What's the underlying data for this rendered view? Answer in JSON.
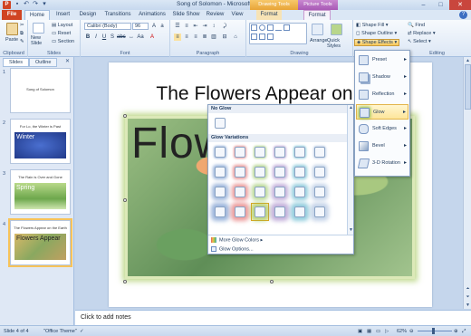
{
  "window": {
    "title": "Song of Solomon - Microsoft PowerPoint",
    "context_drawing": "Drawing Tools",
    "context_picture": "Picture Tools"
  },
  "tabs": [
    "File",
    "Home",
    "Insert",
    "Design",
    "Transitions",
    "Animations",
    "Slide Show",
    "Review",
    "View",
    "Format",
    "Format"
  ],
  "ribbon": {
    "clipboard": {
      "paste": "Paste",
      "label": "Clipboard"
    },
    "slides": {
      "new_slide": "New Slide",
      "layout": "Layout",
      "reset": "Reset",
      "section": "Section",
      "label": "Slides"
    },
    "font": {
      "name": "Calibri (Body)",
      "size": "96",
      "label": "Font"
    },
    "paragraph": {
      "label": "Paragraph"
    },
    "drawing": {
      "arrange": "Arrange",
      "quick_styles": "Quick Styles",
      "label": "Drawing"
    },
    "shape_fill": "Shape Fill",
    "shape_outline": "Shape Outline",
    "shape_effects": "Shape Effects",
    "editing": {
      "find": "Find",
      "replace": "Replace",
      "select": "Select",
      "label": "Editing"
    }
  },
  "left_pane": {
    "tabs": [
      "Slides",
      "Outline"
    ],
    "thumbnails": [
      {
        "num": "1",
        "title": "Song of Solomon",
        "body": ""
      },
      {
        "num": "2",
        "title": "For Lo, the Winter is Past",
        "body": "Winter"
      },
      {
        "num": "3",
        "title": "The Rain is Over and Gone",
        "body": "Spring"
      },
      {
        "num": "4",
        "title": "The Flowers Appear on the Earth",
        "body": "Flowers Appear"
      }
    ]
  },
  "slide": {
    "title": "The Flowers Appear on the",
    "picture_text": "Flow"
  },
  "glow_gallery": {
    "no_glow": "No Glow",
    "variations": "Glow Variations",
    "glow_colors": [
      "#5b86c5",
      "#e05a5a",
      "#8cbf4f",
      "#9a7ac2",
      "#4bacc6",
      "#9cb6d8"
    ],
    "more_colors": "More Glow Colors",
    "options": "Glow Options..."
  },
  "shape_effects_menu": {
    "items": [
      "Preset",
      "Shadow",
      "Reflection",
      "Glow",
      "Soft Edges",
      "Bevel",
      "3-D Rotation"
    ],
    "active": "Glow"
  },
  "notes": {
    "placeholder": "Click to add notes"
  },
  "status": {
    "slide": "Slide 4 of 4",
    "theme": "\"Office Theme\"",
    "zoom": "62%"
  }
}
